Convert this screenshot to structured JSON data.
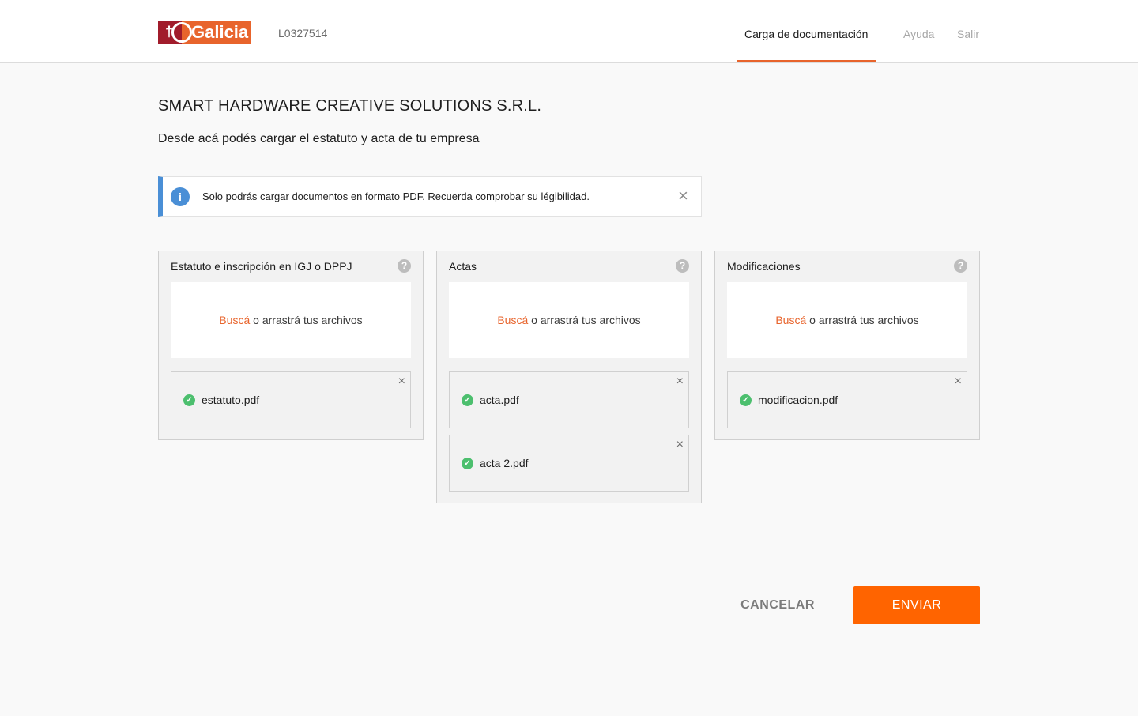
{
  "header": {
    "logo_text": "Galicia",
    "user_id": "L0327514",
    "nav": {
      "active": "Carga de documentación",
      "help": "Ayuda",
      "exit": "Salir"
    }
  },
  "company_name": "SMART HARDWARE CREATIVE SOLUTIONS S.R.L.",
  "subtitle": "Desde acá podés cargar el estatuto y acta de tu empresa",
  "alert": {
    "text": "Solo podrás cargar documentos en formato PDF. Recuerda comprobar su légibilidad.",
    "icon": "info-icon",
    "close": "×"
  },
  "dropzone": {
    "link": "Buscá",
    "text": " o arrastrá tus archivos"
  },
  "sections": [
    {
      "title": "Estatuto e inscripción en IGJ o DPPJ",
      "files": [
        "estatuto.pdf"
      ]
    },
    {
      "title": "Actas",
      "files": [
        "acta.pdf",
        "acta 2.pdf"
      ]
    },
    {
      "title": "Modificaciones",
      "files": [
        "modificacion.pdf"
      ]
    }
  ],
  "icons": {
    "help": "?",
    "check": "✓",
    "remove": "×"
  },
  "buttons": {
    "cancel": "CANCELAR",
    "send": "ENVIAR"
  },
  "colors": {
    "accent": "#ff6400",
    "info": "#4a8fd6",
    "success": "#4cbf6e",
    "brand_red": "#a11c2b"
  }
}
